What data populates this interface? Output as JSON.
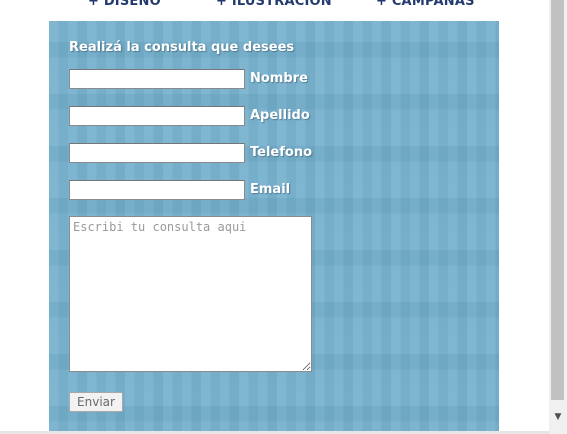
{
  "nav": {
    "items": [
      {
        "label": "+ DISEÑO"
      },
      {
        "label": "+ ILUSTRACION"
      },
      {
        "label": "+ CAMPAÑAS"
      }
    ]
  },
  "form": {
    "title": "Realizá la consulta que desees",
    "fields": [
      {
        "label": "Nombre",
        "value": ""
      },
      {
        "label": "Apellido",
        "value": ""
      },
      {
        "label": "Telefono",
        "value": ""
      },
      {
        "label": "Email",
        "value": ""
      }
    ],
    "consulta_placeholder": "Escribi tu consulta aqui",
    "submit_label": "Enviar"
  },
  "colors": {
    "panel": "#72aecb",
    "nav_text": "#233a6e",
    "label_text": "#ffffff"
  },
  "icons": {
    "scroll_down": "chevron-down-icon"
  }
}
